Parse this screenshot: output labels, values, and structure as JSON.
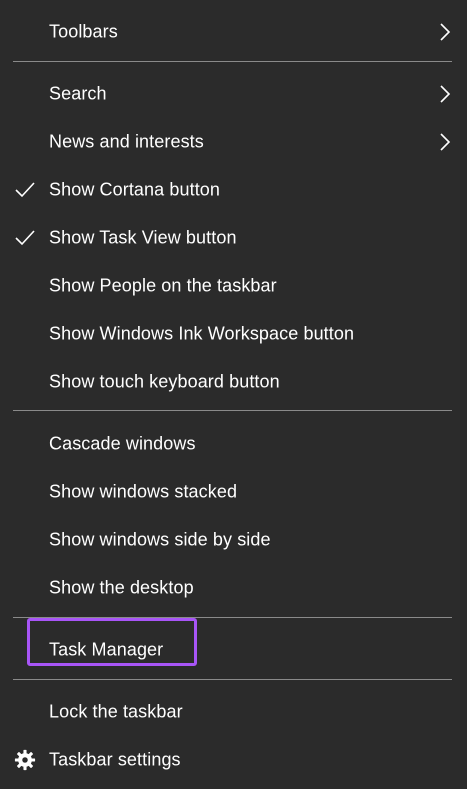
{
  "menu": {
    "items": [
      {
        "label": "Toolbars"
      },
      {
        "label": "Search"
      },
      {
        "label": "News and interests"
      },
      {
        "label": "Show Cortana button"
      },
      {
        "label": "Show Task View button"
      },
      {
        "label": "Show People on the taskbar"
      },
      {
        "label": "Show Windows Ink Workspace button"
      },
      {
        "label": "Show touch keyboard button"
      },
      {
        "label": "Cascade windows"
      },
      {
        "label": "Show windows stacked"
      },
      {
        "label": "Show windows side by side"
      },
      {
        "label": "Show the desktop"
      },
      {
        "label": "Task Manager"
      },
      {
        "label": "Lock the taskbar"
      },
      {
        "label": "Taskbar settings"
      }
    ]
  },
  "colors": {
    "background": "#2b2b2b",
    "text": "#ffffff",
    "divider": "#8a8a8a",
    "highlight": "#a855f7"
  },
  "icons": {
    "submenu": "chevron-right-icon",
    "checked": "checkmark-icon",
    "settings": "gear-icon"
  }
}
